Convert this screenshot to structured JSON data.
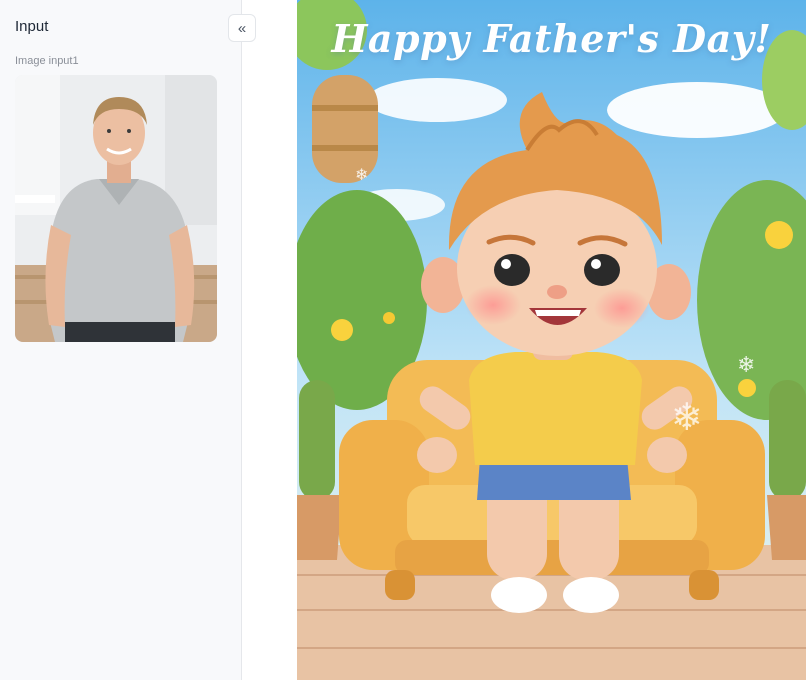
{
  "panel": {
    "title": "Input",
    "collapse_icon": "chevrons-left-icon",
    "collapse_glyph": "«"
  },
  "input_image": {
    "label": "Image input1"
  },
  "output": {
    "banner_text": "Happy Father's Day!"
  }
}
